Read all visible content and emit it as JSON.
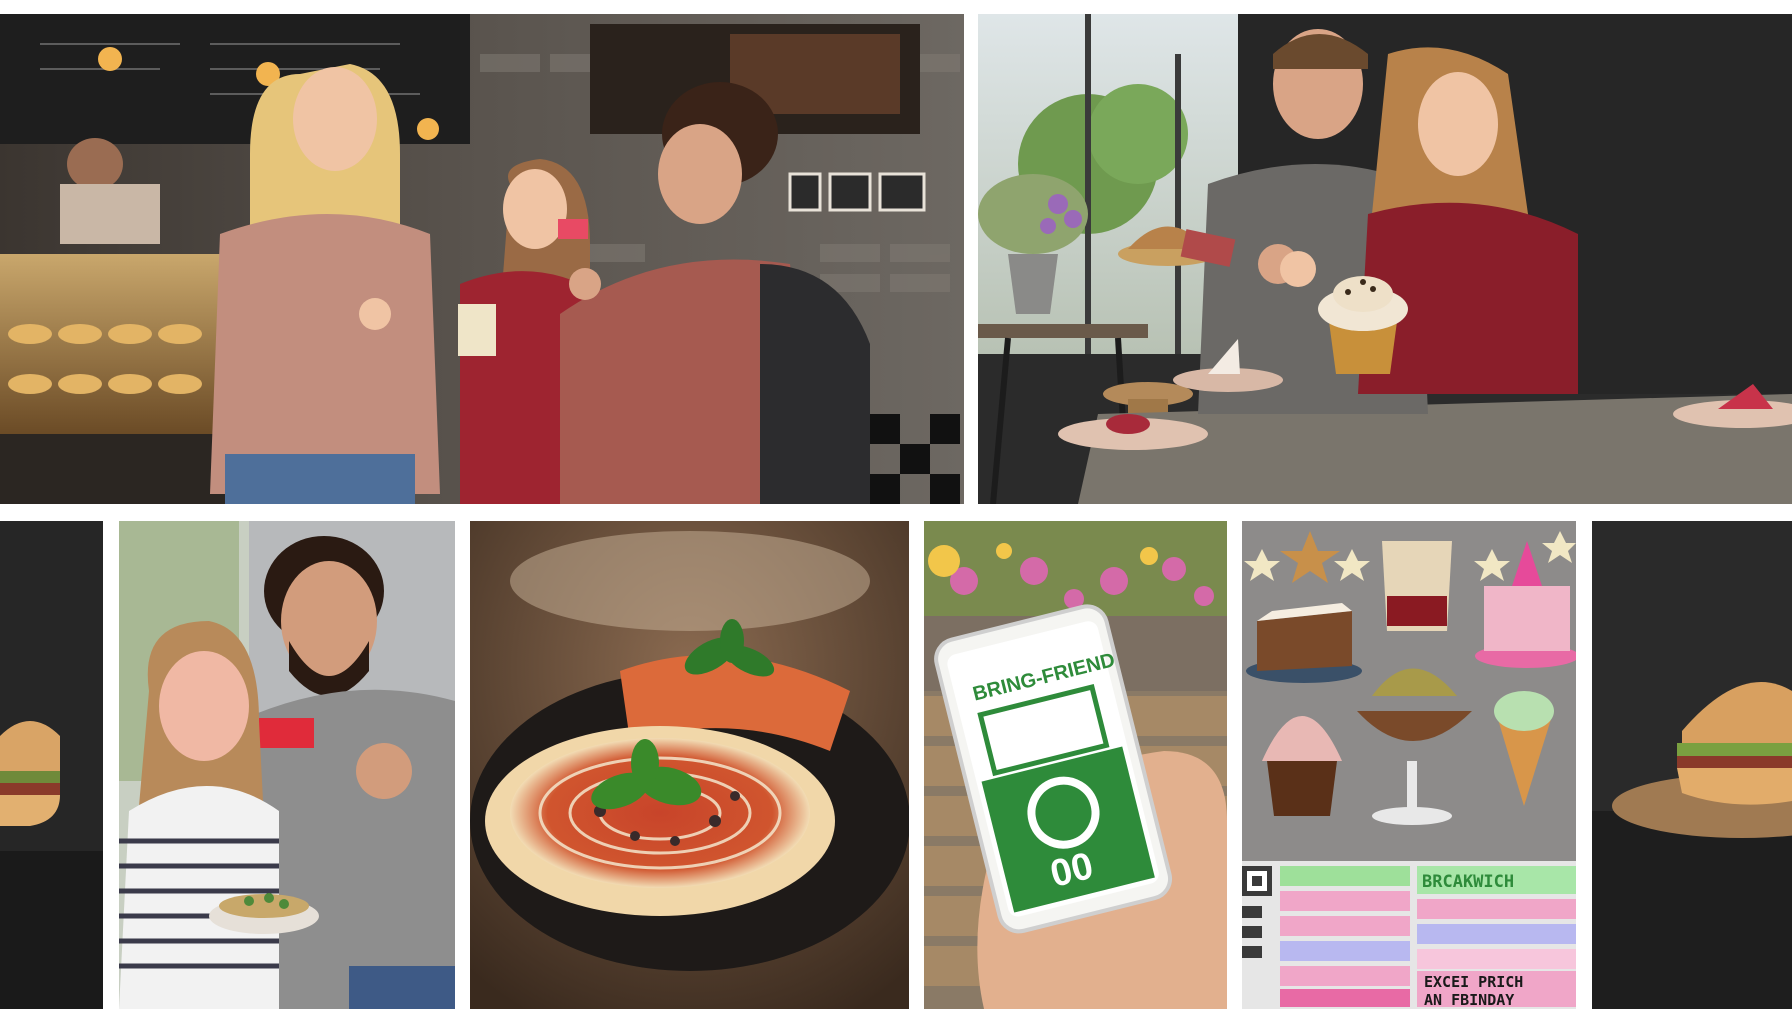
{
  "phone_screen": {
    "heading": "BRING-FRIEND",
    "counter": "00"
  },
  "menu_board": {
    "rows": [
      {
        "left": "",
        "right": "BRCAKWICH"
      },
      {
        "left": "",
        "right": ""
      },
      {
        "left": "",
        "right": ""
      },
      {
        "left": "",
        "right": ""
      },
      {
        "left": "",
        "right": "EXCEI PRICH"
      },
      {
        "left": "",
        "right": "AN FBINDAY"
      }
    ]
  },
  "colors": {
    "background": "#ffffff",
    "accent_green": "#2e8b3a",
    "accent_pink": "#e86aa5",
    "card_red": "#e02b3a"
  }
}
